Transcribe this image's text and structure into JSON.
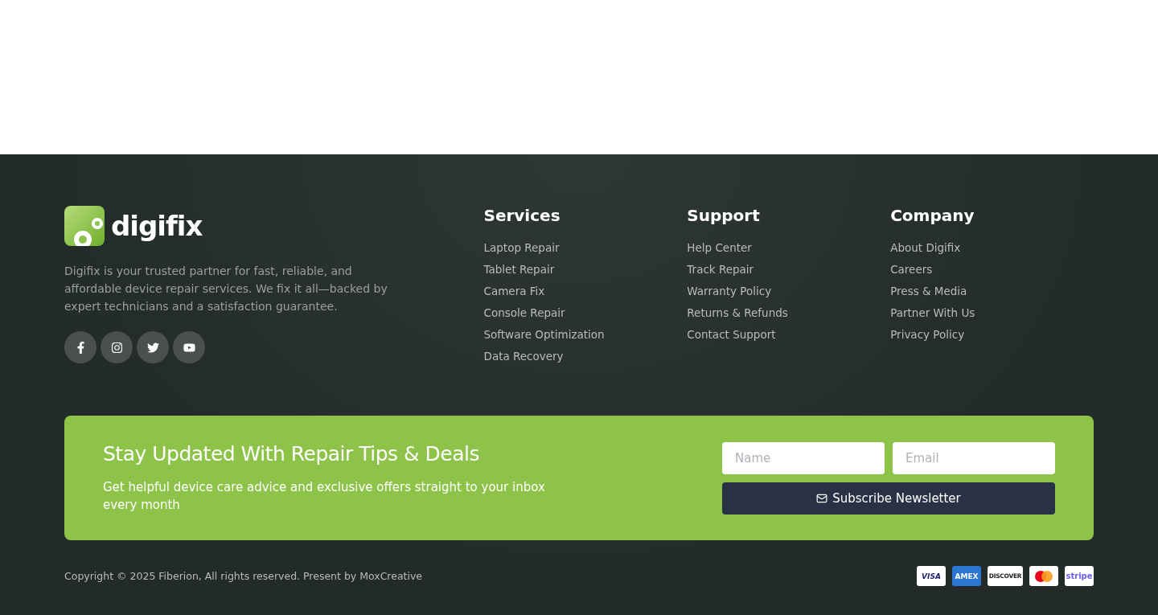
{
  "brand": {
    "name": "digifix",
    "description": "Digifix is your trusted partner for fast, reliable, and affordable device repair services. We fix it all—backed by expert technicians and a satisfaction guarantee."
  },
  "socials": [
    {
      "kind": "facebook"
    },
    {
      "kind": "instagram"
    },
    {
      "kind": "twitter"
    },
    {
      "kind": "youtube"
    }
  ],
  "columns": [
    {
      "title": "Services",
      "links": [
        "Laptop Repair",
        "Tablet Repair",
        "Camera Fix",
        "Console Repair",
        "Software Optimization",
        "Data Recovery"
      ]
    },
    {
      "title": "Support",
      "links": [
        "Help Center",
        "Track Repair",
        "Warranty Policy",
        "Returns & Refunds",
        "Contact Support"
      ]
    },
    {
      "title": "Company",
      "links": [
        "About Digifix",
        "Careers",
        "Press & Media",
        "Partner With Us",
        "Privacy Policy"
      ]
    }
  ],
  "newsletter": {
    "title": "Stay Updated With Repair Tips & Deals",
    "text": "Get helpful device care advice and exclusive offers straight to your inbox every month",
    "name_field": {
      "placeholder": "Name"
    },
    "email_field": {
      "placeholder": "Email"
    },
    "button": "Subscribe Newsletter"
  },
  "copyright": "Copyright © 2025 Fiberion, All rights reserved. Present by MoxCreative",
  "payments": [
    {
      "kind": "visa",
      "label": "VISA"
    },
    {
      "kind": "amex",
      "label": "AMEX"
    },
    {
      "kind": "discover",
      "label": "DISCOVER"
    },
    {
      "kind": "mastercard"
    },
    {
      "kind": "stripe",
      "label": "stripe"
    }
  ]
}
